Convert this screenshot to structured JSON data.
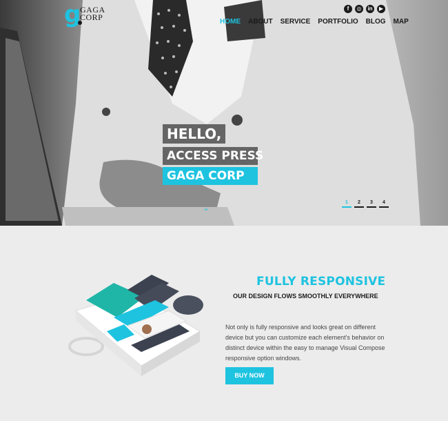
{
  "brand": {
    "logo_letter": "g",
    "logo_text_1": "GAGA",
    "logo_text_2": "CORP"
  },
  "social": [
    {
      "icon": "facebook-icon",
      "glyph": "f"
    },
    {
      "icon": "instagram-icon",
      "glyph": "◎"
    },
    {
      "icon": "linkedin-icon",
      "glyph": "in"
    },
    {
      "icon": "youtube-icon",
      "glyph": "▶"
    }
  ],
  "nav": {
    "home": "HOME",
    "about": "ABOUT",
    "service": "SERVICE",
    "portfolio": "PORTFOLIO",
    "blog": "BLOG",
    "map": "MAP"
  },
  "hero": {
    "line1": "HELLO,",
    "line2": "ACCESS PRESS",
    "line3": "GAGA CORP",
    "slides": [
      "1",
      "2",
      "3",
      "4"
    ]
  },
  "feature": {
    "title": "FULLY RESPONSIVE",
    "subtitle": "OUR DESIGN FLOWS SMOOTHLY EVERYWHERE",
    "description": "Not only is fully responsive and looks great on different device but you can customize each element's behavior on distinct device within the easy to manage Visual Compose responsive option windows.",
    "button": "BUY NOW"
  },
  "colors": {
    "accent": "#1ec3e0",
    "dark": "#1a1a1a",
    "background": "#ececec"
  }
}
